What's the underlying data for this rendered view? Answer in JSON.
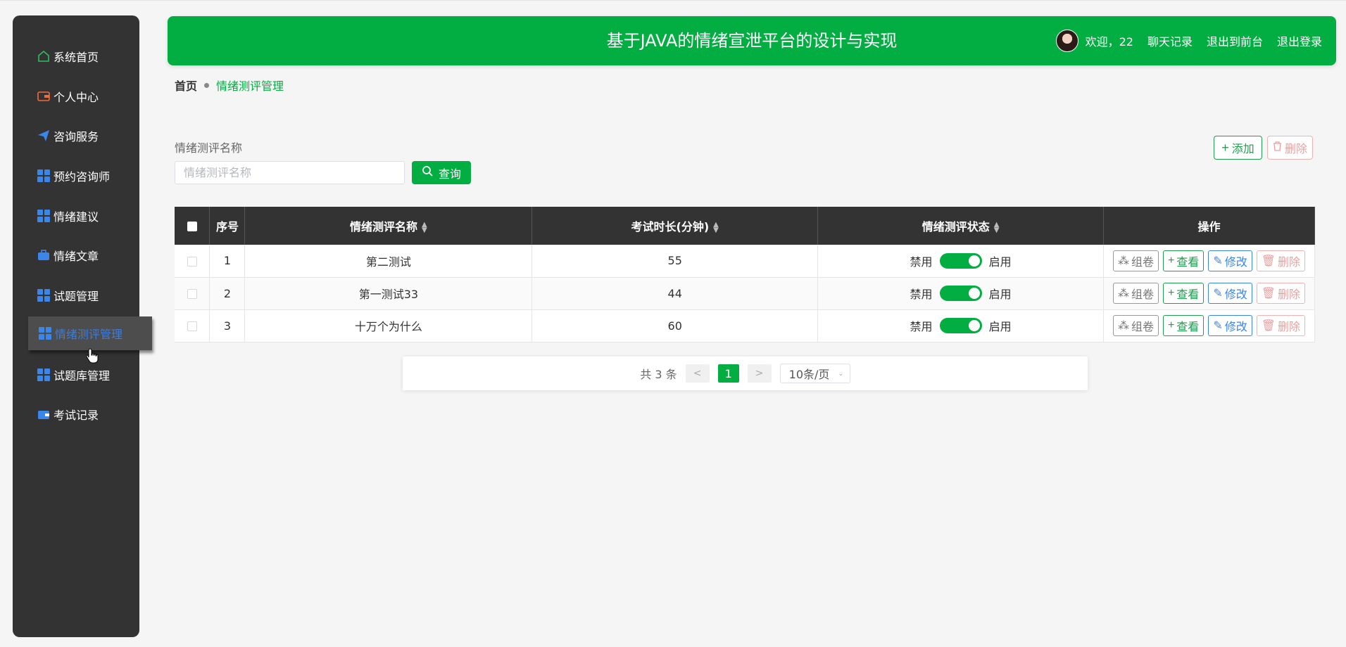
{
  "sidebar": {
    "items": [
      {
        "label": "系统首页",
        "icon": "home-icon"
      },
      {
        "label": "个人中心",
        "icon": "wallet-icon"
      },
      {
        "label": "咨询服务",
        "icon": "paper-plane-icon"
      },
      {
        "label": "预约咨询师",
        "icon": "grid-icon"
      },
      {
        "label": "情绪建议",
        "icon": "grid-icon"
      },
      {
        "label": "情绪文章",
        "icon": "briefcase-icon"
      },
      {
        "label": "试题管理",
        "icon": "grid-icon"
      },
      {
        "label": "情绪测评管理",
        "icon": "grid-icon"
      },
      {
        "label": "试题库管理",
        "icon": "grid-icon"
      },
      {
        "label": "考试记录",
        "icon": "wallet-blue-icon"
      }
    ],
    "active_index": 7
  },
  "header": {
    "title": "基于JAVA的情绪宣泄平台的设计与实现",
    "welcome": "欢迎，22",
    "chat": "聊天记录",
    "exit_front": "退出到前台",
    "logout": "退出登录"
  },
  "breadcrumb": {
    "home": "首页",
    "current": "情绪测评管理"
  },
  "search": {
    "label": "情绪测评名称",
    "placeholder": "情绪测评名称",
    "button": "查询"
  },
  "actions": {
    "add": "添加",
    "delete": "删除"
  },
  "table": {
    "headers": [
      "序号",
      "情绪测评名称",
      "考试时长(分钟)",
      "情绪测评状态",
      "操作"
    ],
    "rows": [
      {
        "index": "1",
        "name": "第二测试",
        "duration": "55"
      },
      {
        "index": "2",
        "name": "第一测试33",
        "duration": "44"
      },
      {
        "index": "3",
        "name": "十万个为什么",
        "duration": "60"
      }
    ],
    "switch_off": "禁用",
    "switch_on": "启用",
    "ops": {
      "group": "组卷",
      "view": "查看",
      "edit": "修改",
      "delete": "删除"
    }
  },
  "pager": {
    "total": "共 3 条",
    "prev": "<",
    "page": "1",
    "next": ">",
    "size": "10条/页"
  },
  "colors": {
    "primary": "#02ad41",
    "sidebar": "#333333",
    "accent_blue": "#3a86ea",
    "danger": "#e8a0a0"
  }
}
